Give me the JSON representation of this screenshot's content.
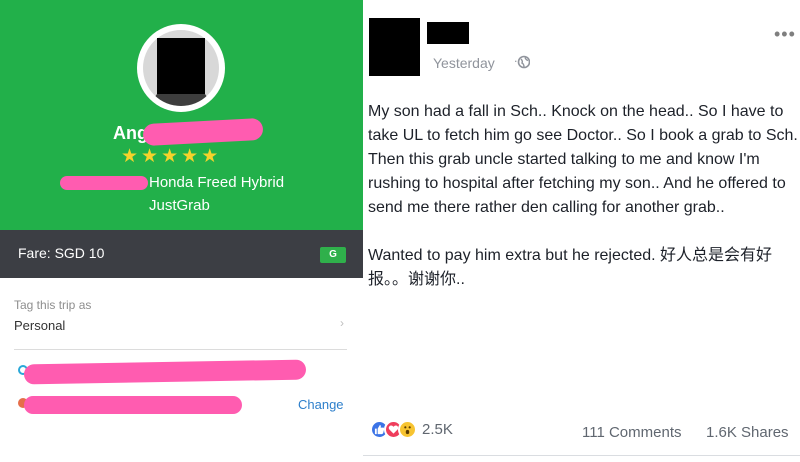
{
  "receipt": {
    "driver_name": "Ang",
    "rating_stars": 5,
    "star_glyph": "★",
    "car_model": "Honda Freed Hybrid",
    "service": "JustGrab",
    "fare": "Fare: SGD 10",
    "fare_badge": "G",
    "tag_label": "Tag this trip as",
    "tag_value": "Personal",
    "chevron": "›",
    "change_label": "Change",
    "brand_green": "#22b04a",
    "redaction_pink": "#ff5cb0"
  },
  "post": {
    "time": "Yesterday",
    "time_separator": "·",
    "more": "•••",
    "paragraphs": [
      "My son had a fall in Sch.. Knock on the head.. So I have to take UL to fetch him go see Doctor.. So I book a grab to Sch. Then this grab uncle started talking to me and know I'm rushing to hospital after fetching my son.. And he offered to send me there rather den calling for another grab..",
      "Wanted to pay him extra but he rejected. 好人总是会有好报。。谢谢你.."
    ],
    "reaction_icons": [
      "like-icon",
      "love-icon",
      "wow-icon"
    ],
    "reaction_count": "2.5K",
    "comments": "111 Comments",
    "shares": "1.6K Shares"
  }
}
